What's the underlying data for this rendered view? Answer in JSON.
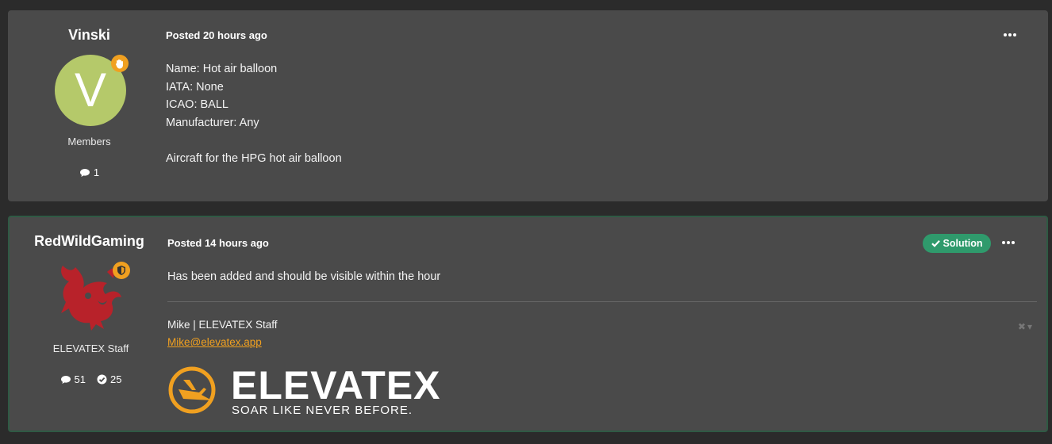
{
  "posts": [
    {
      "author": "Vinski",
      "avatar_letter": "V",
      "group": "Members",
      "comments": "1",
      "posted_label": "Posted 20 hours ago",
      "lines": [
        "Name: Hot air balloon",
        "IATA: None",
        "ICAO: BALL",
        "Manufacturer: Any",
        "",
        "Aircraft for the HPG hot air balloon"
      ]
    },
    {
      "author": "RedWildGaming",
      "group": "ELEVATEX Staff",
      "comments": "51",
      "solutions": "25",
      "posted_label": "Posted 14 hours ago",
      "solution_label": "Solution",
      "lines": [
        "Has been added and should be visible within the hour"
      ],
      "signature": {
        "name": "Mike | ELEVATEX Staff",
        "email": "Mike@elevatex.app",
        "logo_word": "ELEVATEX",
        "logo_tagline": "SOAR LIKE NEVER BEFORE."
      }
    }
  ],
  "colors": {
    "accent": "#f0a020",
    "solution": "#2f9a6c",
    "card": "#4a4a4a",
    "bg": "#2b2b2b"
  }
}
